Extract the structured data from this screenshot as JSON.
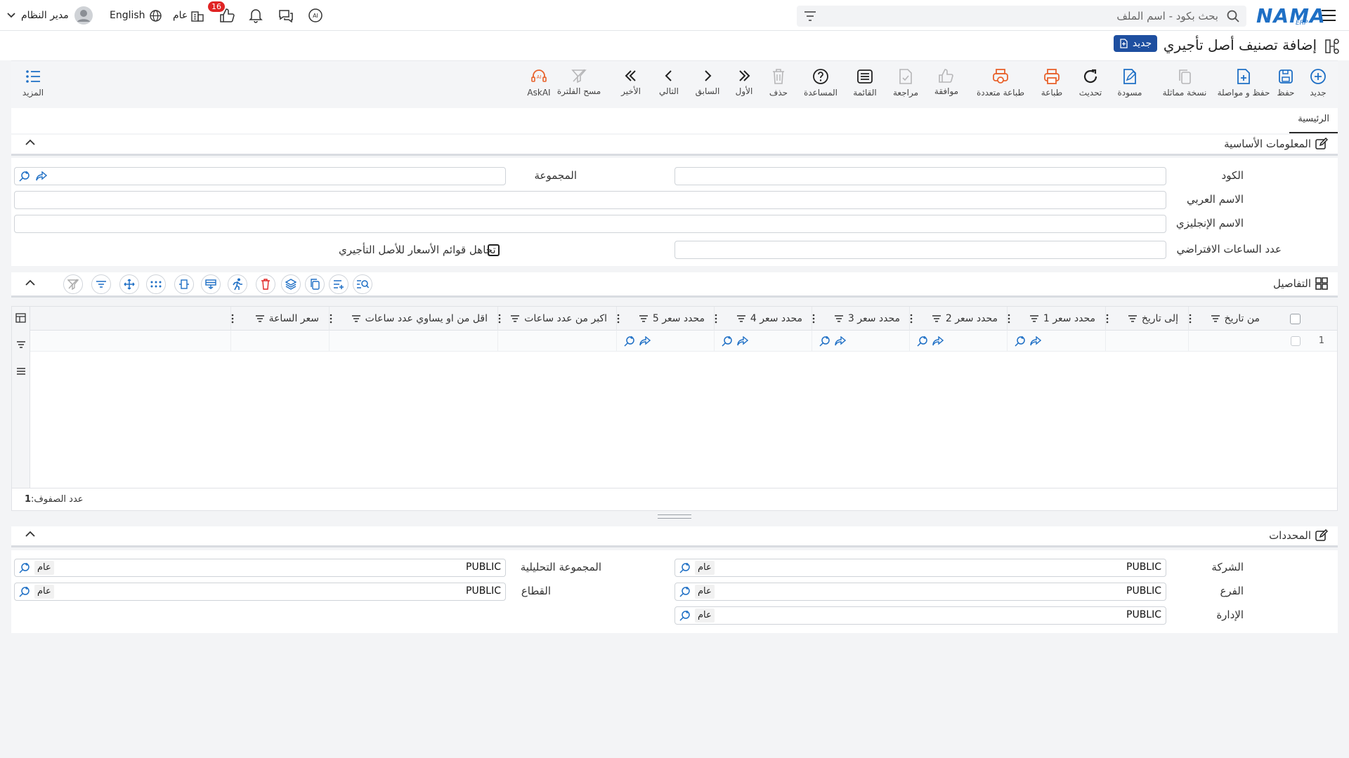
{
  "topbar": {
    "search_placeholder": "بحث بكود - اسم الملف",
    "user_name": "مدير النظام",
    "language": "English",
    "context": "عام",
    "badge_count": "16",
    "logo_text": "NAMA",
    "logo_sub": "ERP"
  },
  "page": {
    "title": "إضافة تصنيف أصل تأجيري",
    "new_badge": "جديد"
  },
  "toolbar": {
    "new": "جديد",
    "save": "حفظ",
    "save_continue": "حفظ و مواصلة",
    "copy": "نسخة مماثلة",
    "draft": "مسودة",
    "refresh": "تحديث",
    "print": "طباعة",
    "multi_print": "طباعة متعددة",
    "approve": "موافقة",
    "review": "مراجعة",
    "list": "القائمة",
    "help": "المساعدة",
    "delete": "حذف",
    "first": "الأول",
    "prev": "السابق",
    "next": "التالي",
    "last": "الأخير",
    "clear_filter": "مسح الفلترة",
    "askai": "AskAI",
    "more": "المزيد"
  },
  "tabs": {
    "main": "الرئيسية"
  },
  "basic": {
    "title": "المعلومات الأساسية",
    "code": "الكود",
    "group": "المجموعة",
    "arabic_name": "الاسم العربي",
    "english_name": "الاسم الإنجليزي",
    "default_hours": "عدد الساعات الافتراضي",
    "ignore_price_lists": "تجاهل قوائم الأسعار للأصل التأجيري"
  },
  "details": {
    "title": "التفاصيل",
    "columns": [
      "من تاريخ",
      "إلى تاريخ",
      "محدد سعر 1",
      "محدد سعر 2",
      "محدد سعر 3",
      "محدد سعر 4",
      "محدد سعر 5",
      "اكبر من عدد ساعات",
      "اقل من او يساوي عدد ساعات",
      "سعر الساعة"
    ],
    "row_number": "1",
    "row_count_label": "عدد الصفوف:",
    "row_count": "1"
  },
  "dims": {
    "title": "المحددات",
    "company": "الشركة",
    "branch": "الفرع",
    "department": "الإدارة",
    "analytic_group": "المجموعة التحليلية",
    "sector": "القطاع",
    "value": "PUBLIC",
    "value_label": "عام"
  },
  "colors": {
    "accent": "#1e6fc5",
    "orange": "#e8622c",
    "badge": "#e02424"
  }
}
